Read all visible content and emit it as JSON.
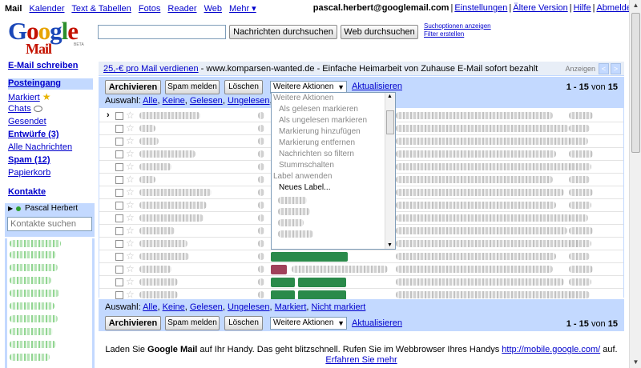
{
  "topnav": {
    "items": [
      "Mail",
      "Kalender",
      "Text & Tabellen",
      "Fotos",
      "Reader",
      "Web",
      "Mehr ▾"
    ]
  },
  "user": {
    "email": "pascal.herbert@googlemail.com",
    "links": [
      "Einstellungen",
      "Ältere Version",
      "Hilfe",
      "Abmelden"
    ]
  },
  "logo": {
    "google": "Google",
    "mail": "Mail",
    "beta": "BETA"
  },
  "search": {
    "value": "",
    "mail_button": "Nachrichten durchsuchen",
    "web_button": "Web durchsuchen",
    "options": "Suchoptionen anzeigen",
    "filter": "Filter erstellen"
  },
  "leftnav": {
    "compose": "E-Mail schreiben",
    "inbox": "Posteingang",
    "starred": "Markiert",
    "chats": "Chats",
    "sent": "Gesendet",
    "drafts": "Entwürfe (3)",
    "all": "Alle Nachrichten",
    "spam": "Spam (12)",
    "trash": "Papierkorb",
    "contacts": "Kontakte"
  },
  "chat": {
    "user": "Pascal Herbert",
    "search_placeholder": "Kontakte suchen"
  },
  "ad": {
    "link": "25,-€ pro Mail verdienen",
    "text": " - www.komparsen-wanted.de - Einfache Heimarbeit von Zuhause E-Mail sofort bezahlt",
    "label": "Anzeigen"
  },
  "toolbar": {
    "archive": "Archivieren",
    "spam": "Spam melden",
    "delete": "Löschen",
    "more_actions": "Weitere Aktionen",
    "refresh": "Aktualisieren",
    "count_range": "1 - 15",
    "count_of": "von",
    "count_total": "15"
  },
  "selection": {
    "label": "Auswahl:",
    "links": [
      "Alle",
      "Keine",
      "Gelesen",
      "Ungelesen",
      "Markiert",
      "Nicht markiert"
    ]
  },
  "dropdown": {
    "options": [
      "Weitere Aktionen",
      "Als gelesen markieren",
      "Als ungelesen markieren",
      "Markierung hinzufügen",
      "Markierung entfernen",
      "Nachrichten so filtern",
      "Stummschalten",
      "Label anwenden",
      "Neues Label..."
    ]
  },
  "footer": {
    "text1": "Laden Sie ",
    "bold": "Google Mail",
    "text2": " auf Ihr Handy. Das geht blitzschnell. Rufen Sie im Webbrowser Ihres Handys ",
    "url": "http://mobile.google.com/",
    "text3": " auf. ",
    "more": "Erfahren Sie mehr"
  },
  "colors": {
    "accent": "#c3d9ff",
    "link": "#0000cc",
    "brand_red": "#c41200"
  }
}
